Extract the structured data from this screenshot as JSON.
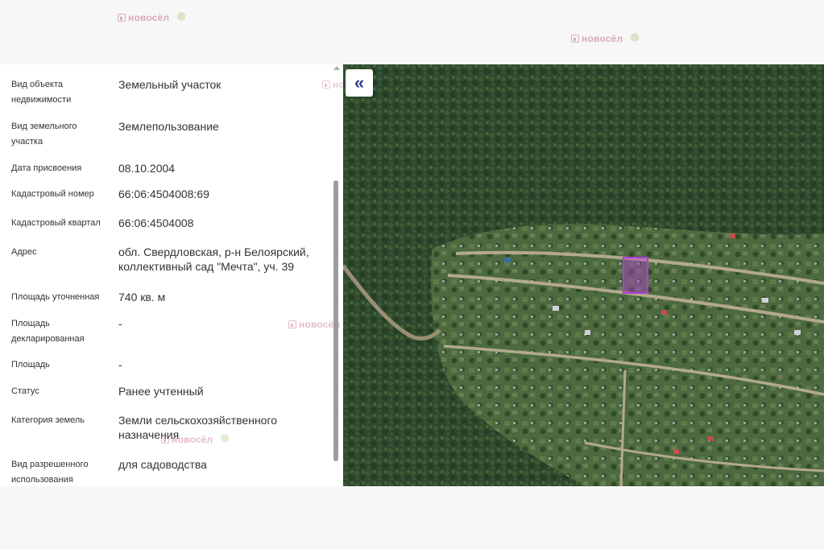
{
  "watermark": {
    "brand": "новосёл"
  },
  "controls": {
    "collapse_glyph": "«"
  },
  "properties": [
    {
      "label": "Вид объекта недвижимости",
      "value": "Земельный участок"
    },
    {
      "label": "Вид земельного участка",
      "value": "Землепользование"
    },
    {
      "label": "Дата присвоения",
      "value": "08.10.2004"
    },
    {
      "label": "Кадастровый номер",
      "value": "66:06:4504008:69"
    },
    {
      "label": "Кадастровый квартал",
      "value": "66:06:4504008"
    },
    {
      "label": "Адрес",
      "value": "обл. Свердловская, р-н Белоярский, коллективный сад \"Мечта\", уч. 39"
    },
    {
      "label": "Площадь уточненная",
      "value": "740 кв. м"
    },
    {
      "label": "Площадь декларированная",
      "value": "-"
    },
    {
      "label": "Площадь",
      "value": "-"
    },
    {
      "label": "Статус",
      "value": "Ранее учтенный"
    },
    {
      "label": "Категория земель",
      "value": "Земли сельскохозяйственного назначения"
    },
    {
      "label": "Вид разрешенного использования",
      "value": "для садоводства"
    }
  ],
  "colors": {
    "parcel_highlight": "#b040d0",
    "forest": "#2f4a2e",
    "brand": "#c46a88"
  }
}
